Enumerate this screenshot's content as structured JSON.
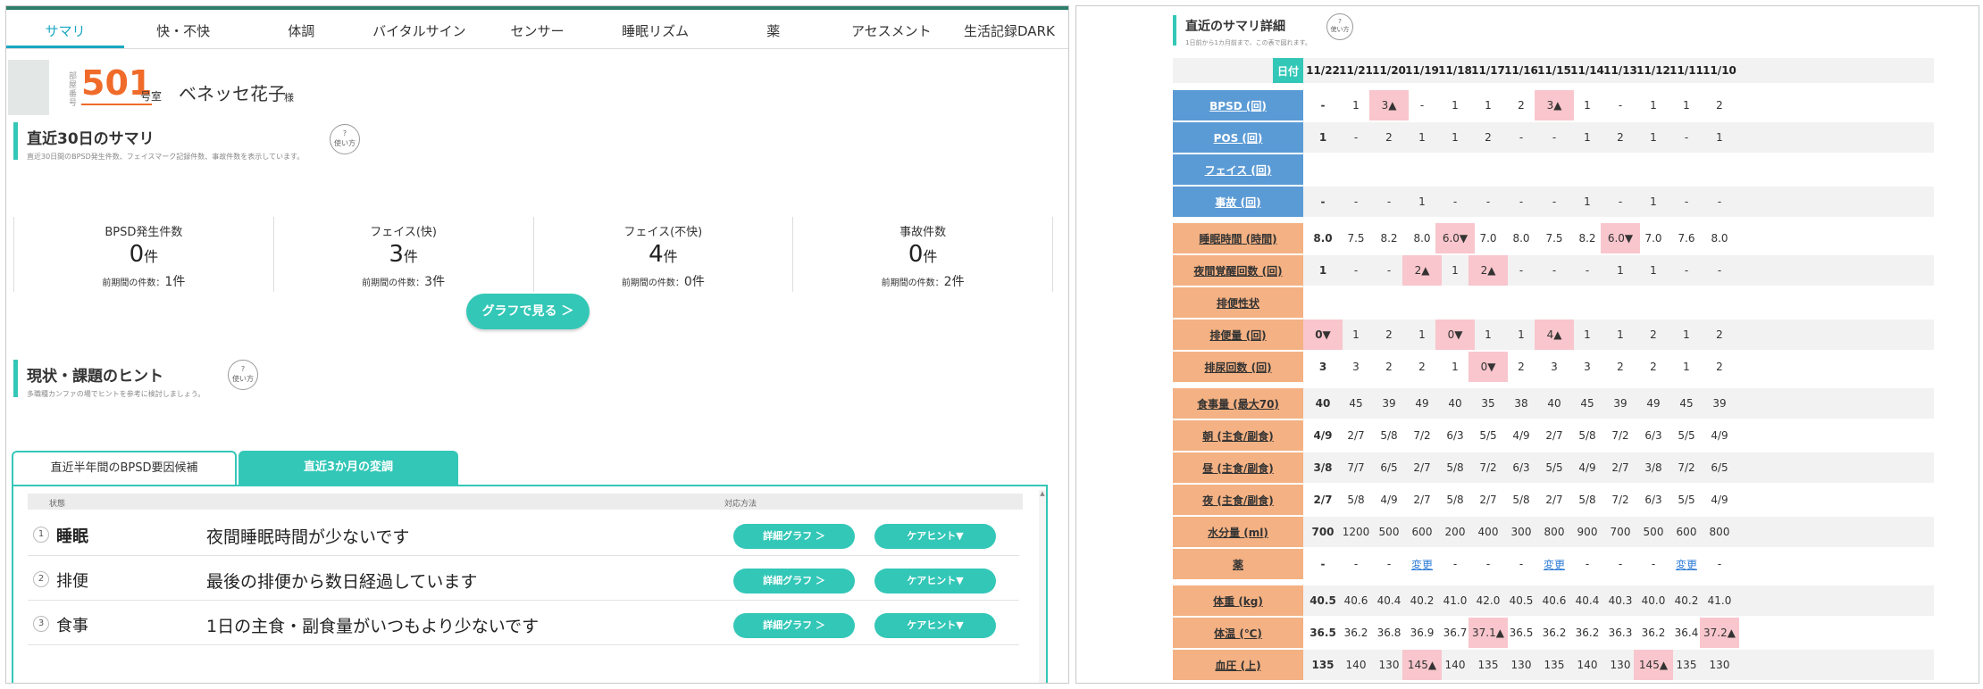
{
  "tabs": [
    "サマリ",
    "快・不快",
    "体調",
    "バイタルサイン",
    "センサー",
    "睡眠リズム",
    "薬",
    "アセスメント",
    "生活記録DARK"
  ],
  "profile": {
    "room_label": "部屋番号",
    "room_number": "501",
    "room_suffix": "号室",
    "name": "ベネッセ花子",
    "honorific": "様"
  },
  "summary30": {
    "title": "直近30日のサマリ",
    "subtitle": "直近30日間のBPSD発生件数、フェイスマーク記録件数、事故件数を表示しています。",
    "howto": "使い方",
    "stats": [
      {
        "label": "BPSD発生件数",
        "value": "0",
        "unit": "件",
        "prev_label": "前期間の件数：",
        "prev_value": "1件"
      },
      {
        "label": "フェイス(快)",
        "value": "3",
        "unit": "件",
        "prev_label": "前期間の件数：",
        "prev_value": "3件"
      },
      {
        "label": "フェイス(不快)",
        "value": "4",
        "unit": "件",
        "prev_label": "前期間の件数：",
        "prev_value": "0件"
      },
      {
        "label": "事故件数",
        "value": "0",
        "unit": "件",
        "prev_label": "前期間の件数：",
        "prev_value": "2件"
      }
    ],
    "graph_button": "グラフで見る ＞"
  },
  "hints": {
    "title": "現状・課題のヒント",
    "subtitle": "多職種カンファの場でヒントを参考に検討しましょう。",
    "howto": "使い方",
    "subtabs": [
      "直近半年間のBPSD要因候補",
      "直近3か月の変調"
    ],
    "col_status": "状態",
    "col_action": "対応方法",
    "rows": [
      {
        "num": "1",
        "category": "睡眠",
        "text": "夜間睡眠時間が少ないです",
        "btn1": "詳細グラフ ＞",
        "btn2": "ケアヒント▼"
      },
      {
        "num": "2",
        "category": "排便",
        "text": "最後の排便から数日経過しています",
        "btn1": "詳細グラフ ＞",
        "btn2": "ケアヒント▼"
      },
      {
        "num": "3",
        "category": "食事",
        "text": "1日の主食・副食量がいつもより少ないです",
        "btn1": "詳細グラフ ＞",
        "btn2": "ケアヒント▼"
      }
    ]
  },
  "detail": {
    "title": "直近のサマリ詳細",
    "subtitle": "1日前から1カ月前まで、この表で図れます。",
    "howto": "使い方",
    "date_label": "日付",
    "dates": [
      "11/22",
      "11/21",
      "11/20",
      "11/19",
      "11/18",
      "11/17",
      "11/16",
      "11/15",
      "11/14",
      "11/13",
      "11/12",
      "11/11",
      "11/10"
    ],
    "rows": [
      {
        "label": "BPSD (回)",
        "color": "blue",
        "cells": [
          "-",
          "1",
          "3▲",
          "-",
          "1",
          "1",
          "2",
          "3▲",
          "1",
          "-",
          "1",
          "1",
          "2"
        ],
        "hl": [
          2,
          7
        ]
      },
      {
        "label": "POS (回)",
        "color": "blue",
        "cells": [
          "1",
          "-",
          "2",
          "1",
          "1",
          "2",
          "-",
          "-",
          "1",
          "2",
          "1",
          "-",
          "1"
        ],
        "hl": []
      },
      {
        "label": "フェイス (回)",
        "color": "blue",
        "cells": [
          "",
          "",
          "",
          "",
          "",
          "",
          "",
          "",
          "",
          "",
          "",
          "",
          ""
        ],
        "hl": []
      },
      {
        "label": "事故 (回)",
        "color": "blue",
        "cells": [
          "-",
          "-",
          "-",
          "1",
          "-",
          "-",
          "-",
          "-",
          "1",
          "-",
          "1",
          "-",
          "-"
        ],
        "hl": []
      },
      {
        "label": "睡眠時間 (時間)",
        "color": "orange",
        "cells": [
          "8.0",
          "7.5",
          "8.2",
          "8.0",
          "6.0▼",
          "7.0",
          "8.0",
          "7.5",
          "8.2",
          "6.0▼",
          "7.0",
          "7.6",
          "8.0"
        ],
        "hl": [
          4,
          9
        ]
      },
      {
        "label": "夜間覚醒回数 (回)",
        "color": "orange",
        "cells": [
          "1",
          "-",
          "-",
          "2▲",
          "1",
          "2▲",
          "-",
          "-",
          "-",
          "1",
          "1",
          "-",
          "-"
        ],
        "hl": [
          3,
          5
        ]
      },
      {
        "label": "排便性状",
        "color": "orange",
        "cells": [
          "",
          "",
          "",
          "",
          "",
          "",
          "",
          "",
          "",
          "",
          "",
          "",
          ""
        ],
        "hl": []
      },
      {
        "label": "排便量 (回)",
        "color": "orange",
        "cells": [
          "0▼",
          "1",
          "2",
          "1",
          "0▼",
          "1",
          "1",
          "4▲",
          "1",
          "1",
          "2",
          "1",
          "2"
        ],
        "hl": [
          0,
          4,
          7
        ]
      },
      {
        "label": "排尿回数 (回)",
        "color": "orange",
        "cells": [
          "3",
          "3",
          "2",
          "2",
          "1",
          "0▼",
          "2",
          "3",
          "3",
          "2",
          "2",
          "1",
          "2"
        ],
        "hl": [
          5
        ]
      },
      {
        "label": "食事量 (最大70)",
        "color": "orange",
        "cells": [
          "40",
          "45",
          "39",
          "49",
          "40",
          "35",
          "38",
          "40",
          "45",
          "39",
          "49",
          "45",
          "39"
        ],
        "hl": []
      },
      {
        "label": "朝 (主食/副食)",
        "color": "orange",
        "cells": [
          "4/9",
          "2/7",
          "5/8",
          "7/2",
          "6/3",
          "5/5",
          "4/9",
          "2/7",
          "5/8",
          "7/2",
          "6/3",
          "5/5",
          "4/9"
        ],
        "hl": []
      },
      {
        "label": "昼 (主食/副食)",
        "color": "orange",
        "cells": [
          "3/8",
          "7/7",
          "6/5",
          "2/7",
          "5/8",
          "7/2",
          "6/3",
          "5/5",
          "4/9",
          "2/7",
          "3/8",
          "7/2",
          "6/5"
        ],
        "hl": []
      },
      {
        "label": "夜 (主食/副食)",
        "color": "orange",
        "cells": [
          "2/7",
          "5/8",
          "4/9",
          "2/7",
          "5/8",
          "2/7",
          "5/8",
          "2/7",
          "5/8",
          "7/2",
          "6/3",
          "5/5",
          "4/9"
        ],
        "hl": []
      },
      {
        "label": "水分量 (ml)",
        "color": "orange",
        "cells": [
          "700",
          "1200",
          "500",
          "600",
          "200",
          "400",
          "300",
          "800",
          "900",
          "700",
          "500",
          "600",
          "800"
        ],
        "hl": []
      },
      {
        "label": "薬",
        "color": "orange",
        "cells": [
          "-",
          "-",
          "-",
          "変更",
          "-",
          "-",
          "-",
          "変更",
          "-",
          "-",
          "-",
          "変更",
          "-"
        ],
        "hl": [],
        "links": [
          3,
          7,
          11
        ]
      },
      {
        "label": "体重 (kg)",
        "color": "orange",
        "cells": [
          "40.5",
          "40.6",
          "40.4",
          "40.2",
          "41.0",
          "42.0",
          "40.5",
          "40.6",
          "40.4",
          "40.3",
          "40.0",
          "40.2",
          "41.0"
        ],
        "hl": []
      },
      {
        "label": "体温 (℃)",
        "color": "orange",
        "cells": [
          "36.5",
          "36.2",
          "36.8",
          "36.9",
          "36.7",
          "37.1▲",
          "36.5",
          "36.2",
          "36.2",
          "36.3",
          "36.2",
          "36.4",
          "37.2▲"
        ],
        "hl": [
          5,
          12
        ]
      },
      {
        "label": "血圧 (上)",
        "color": "orange",
        "cells": [
          "135",
          "140",
          "130",
          "145▲",
          "140",
          "135",
          "130",
          "135",
          "140",
          "130",
          "145▲",
          "135",
          "130"
        ],
        "hl": [
          3,
          10
        ]
      }
    ]
  }
}
